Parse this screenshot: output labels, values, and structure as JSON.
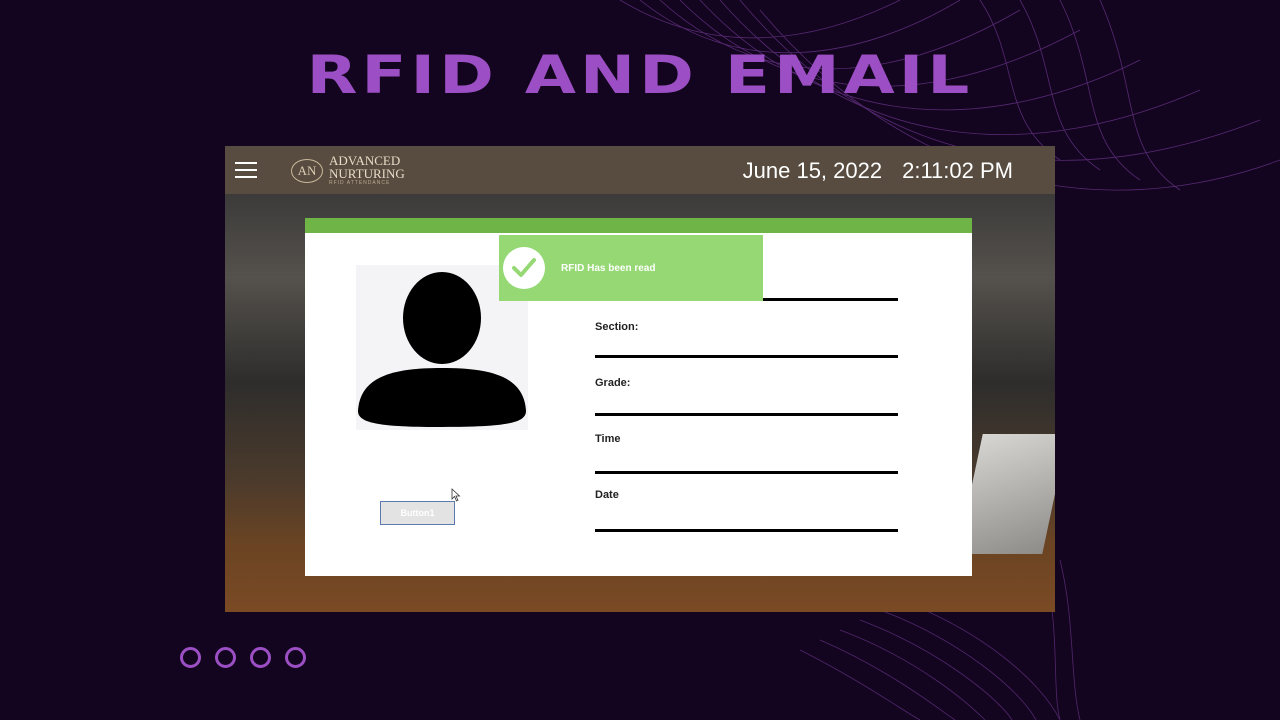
{
  "slide": {
    "title": "RFID AND EMAIL",
    "accent_color": "#9c4fc4",
    "background_color": "#13051f",
    "pagination_dots": 4
  },
  "app": {
    "header": {
      "menu_icon": "hamburger-menu-icon",
      "logo": {
        "mark": "AN",
        "line1": "ADVANCED",
        "line2": "NURTURING",
        "tagline": "RFID ATTENDANCE"
      },
      "date": "June 15, 2022",
      "time": "2:11:02 PM"
    },
    "card": {
      "accent_color": "#6fb447",
      "avatar_icon": "user-silhouette-icon",
      "button_label": "Button1",
      "fields": [
        {
          "label": "Section:"
        },
        {
          "label": "Grade:"
        },
        {
          "label": "Time"
        },
        {
          "label": "Date"
        }
      ]
    },
    "toast": {
      "icon": "checkmark-icon",
      "message": "RFID Has been read",
      "color": "#95d874"
    }
  }
}
